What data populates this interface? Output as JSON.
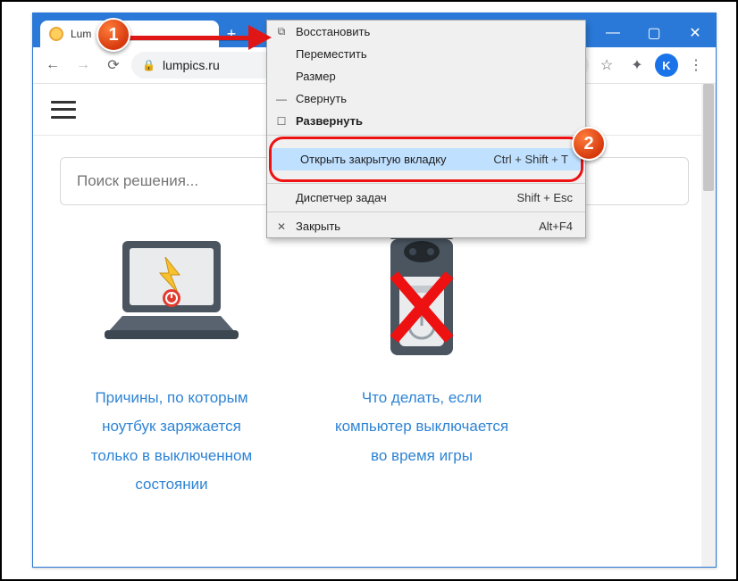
{
  "window": {
    "tab_title": "Lum",
    "minimize_glyph": "—",
    "maximize_glyph": "▢",
    "close_glyph": "✕",
    "newtab_glyph": "+"
  },
  "addressbar": {
    "back_glyph": "←",
    "forward_glyph": "→",
    "reload_glyph": "⟳",
    "lock_glyph": "🔒",
    "url": "lumpics.ru",
    "star_glyph": "☆",
    "ext_glyph": "✦",
    "avatar_letter": "K",
    "menu_glyph": "⋮"
  },
  "site": {
    "search_placeholder": "Поиск решения..."
  },
  "cards": [
    {
      "title": "Причины, по которым ноутбук заряжается только в выключенном состоянии"
    },
    {
      "title": "Что делать, если компьютер выключается во время игры"
    }
  ],
  "contextmenu": {
    "restore": "Восстановить",
    "move": "Переместить",
    "size": "Размер",
    "minimize": "Свернуть",
    "maximize": "Развернуть",
    "reopen_tab": "Открыть закрытую вкладку",
    "reopen_tab_shortcut": "Ctrl + Shift + T",
    "task_manager": "Диспетчер задач",
    "task_manager_shortcut": "Shift + Esc",
    "close": "Закрыть",
    "close_shortcut": "Alt+F4",
    "restore_icon": "⧉",
    "minimize_icon": "—",
    "maximize_icon": "☐",
    "close_icon": "✕"
  },
  "annotations": {
    "step1": "1",
    "step2": "2"
  }
}
